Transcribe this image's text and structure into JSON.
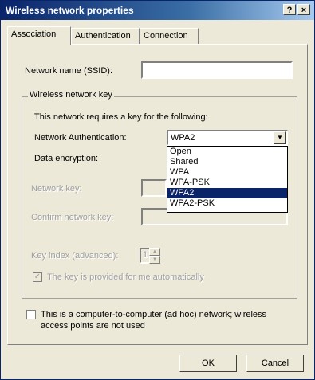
{
  "window": {
    "title": "Wireless network properties",
    "help_glyph": "?",
    "close_glyph": "×"
  },
  "tabs": [
    {
      "label": "Association",
      "active": true
    },
    {
      "label": "Authentication",
      "active": false
    },
    {
      "label": "Connection",
      "active": false
    }
  ],
  "ssid": {
    "label": "Network name (SSID):",
    "value": ""
  },
  "wireless_key": {
    "group_label": "Wireless network key",
    "requires_text": "This network requires a key for the following:",
    "auth_label": "Network Authentication:",
    "auth_value": "WPA2",
    "auth_options": [
      "Open",
      "Shared",
      "WPA",
      "WPA-PSK",
      "WPA2",
      "WPA2-PSK"
    ],
    "auth_highlighted": "WPA2",
    "encryption_label": "Data encryption:",
    "network_key_label": "Network key:",
    "confirm_key_label": "Confirm network key:",
    "key_index_label": "Key index (advanced):",
    "key_index_value": "1",
    "auto_key_label": "The key is provided for me automatically",
    "auto_key_checked": true
  },
  "adhoc": {
    "label_line1": "This is a computer-to-computer (ad hoc) network; wireless",
    "label_line2": "access points are not used",
    "checked": false
  },
  "buttons": {
    "ok": "OK",
    "cancel": "Cancel"
  }
}
